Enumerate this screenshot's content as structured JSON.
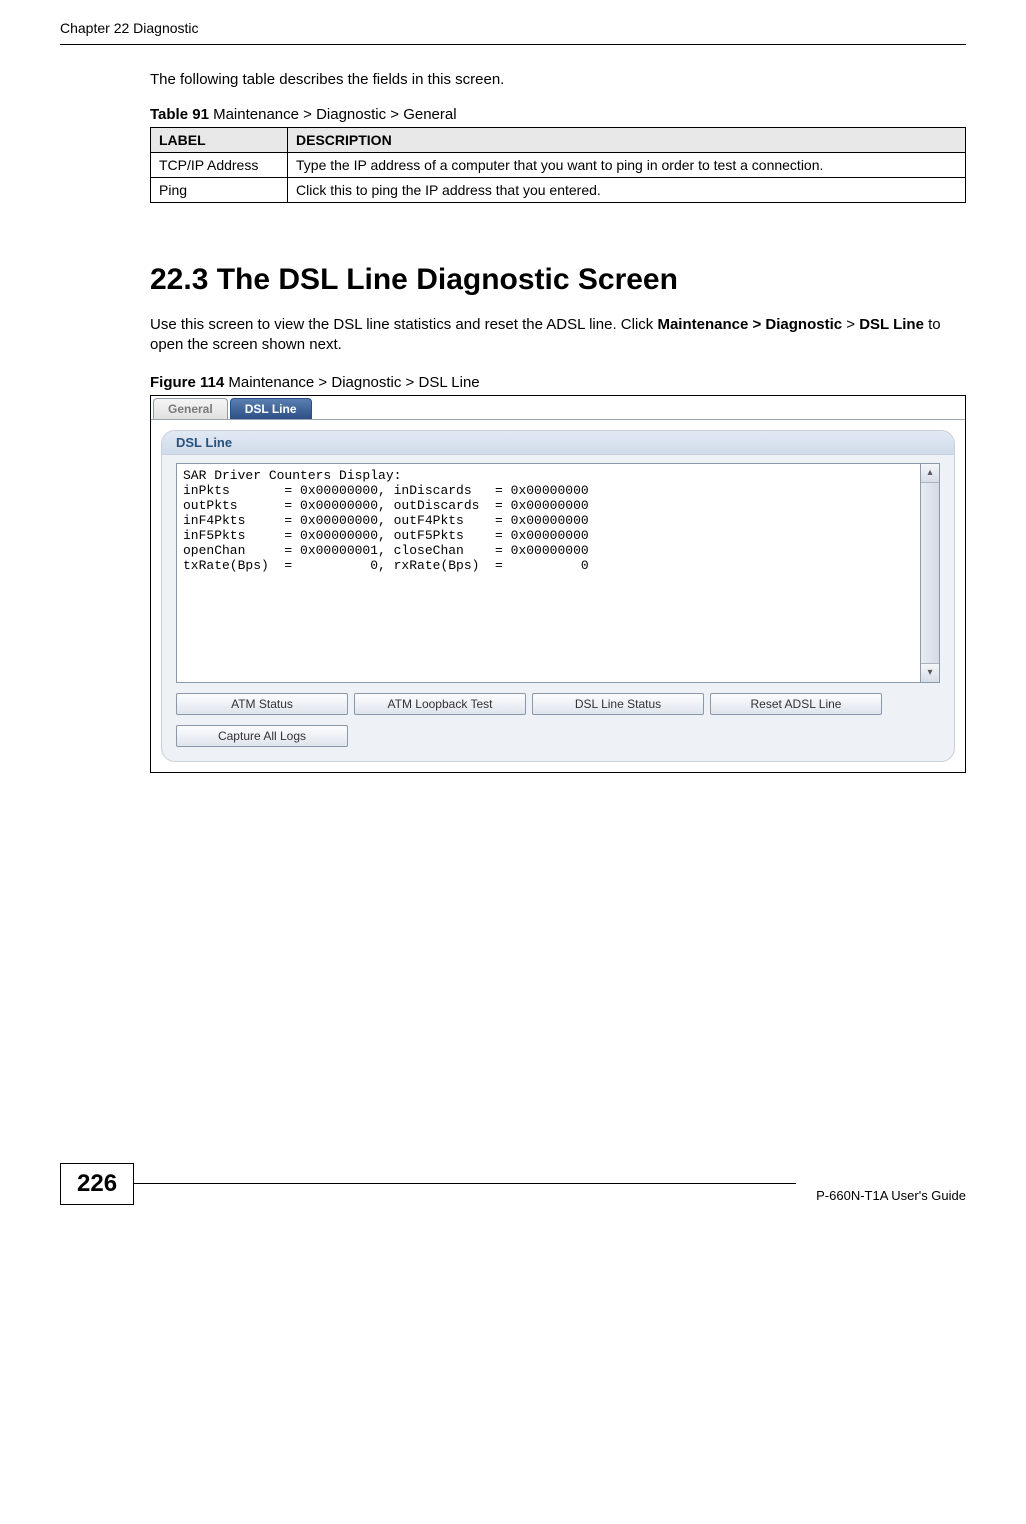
{
  "runningHead": "Chapter 22 Diagnostic",
  "introText": "The following table describes the fields in this screen.",
  "table91": {
    "captionNum": "Table 91",
    "captionRest": "   Maintenance > Diagnostic > General",
    "headLabel": "LABEL",
    "headDesc": "DESCRIPTION",
    "rows": [
      {
        "label": "TCP/IP Address",
        "desc": "Type the IP address of a computer that you want to ping in order to test a connection."
      },
      {
        "label": "Ping",
        "desc": "Click this to ping the IP address that you entered."
      }
    ]
  },
  "section": {
    "num": "22.3",
    "title": "  The DSL Line Diagnostic Screen"
  },
  "bodyText": {
    "part1": "Use this screen to view the DSL line statistics and reset the ADSL line. Click ",
    "bold1": "Maintenance > Diagnostic",
    "part2": " > ",
    "bold2": "DSL Line",
    "part3": " to open the screen shown next."
  },
  "figure": {
    "num": "Figure 114",
    "rest": "   Maintenance > Diagnostic > DSL Line"
  },
  "screenshot": {
    "tabGeneral": "General",
    "tabDSL": "DSL Line",
    "panelTitle": "DSL Line",
    "monoText": "SAR Driver Counters Display:\ninPkts       = 0x00000000, inDiscards   = 0x00000000\noutPkts      = 0x00000000, outDiscards  = 0x00000000\ninF4Pkts     = 0x00000000, outF4Pkts    = 0x00000000\ninF5Pkts     = 0x00000000, outF5Pkts    = 0x00000000\nopenChan     = 0x00000001, closeChan    = 0x00000000\ntxRate(Bps)  =          0, rxRate(Bps)  =          0",
    "buttons": {
      "atmStatus": "ATM Status",
      "atmLoopback": "ATM Loopback Test",
      "dslLineStatus": "DSL Line Status",
      "resetAdsl": "Reset ADSL Line",
      "captureAll": "Capture All Logs"
    },
    "scrollUpGlyph": "▴",
    "scrollDownGlyph": "▾"
  },
  "pageNumber": "226",
  "guideName": "P-660N-T1A User's Guide"
}
